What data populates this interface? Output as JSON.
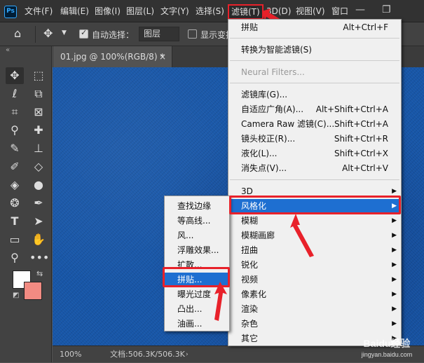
{
  "menubar": {
    "logo": "Ps",
    "items": [
      "文件(F)",
      "编辑(E)",
      "图像(I)",
      "图层(L)",
      "文字(Y)",
      "选择(S)",
      "滤镜(T)",
      "3D(D)",
      "视图(V)",
      "窗口"
    ],
    "window_controls": [
      "—",
      "❐"
    ]
  },
  "options": {
    "auto_select_label": "自动选择：",
    "layer_select_value": "图层",
    "show_transform_label": "显示变换"
  },
  "document": {
    "tab_title": "01.jpg @ 100%(RGB/8) *",
    "tab_close": "×",
    "zoom": "100%",
    "doc_info": "文档:506.3K/506.3K"
  },
  "filter_menu": {
    "items": [
      {
        "label": "拼贴",
        "shortcut": "Alt+Ctrl+F"
      },
      {
        "label": "转换为智能滤镜(S)",
        "shortcut": ""
      },
      {
        "label": "Neural Filters...",
        "shortcut": "",
        "disabled": true
      },
      {
        "label": "滤镜库(G)...",
        "shortcut": ""
      },
      {
        "label": "自适应广角(A)...",
        "shortcut": "Alt+Shift+Ctrl+A"
      },
      {
        "label": "Camera Raw 滤镜(C)...",
        "shortcut": "Shift+Ctrl+A"
      },
      {
        "label": "镜头校正(R)...",
        "shortcut": "Shift+Ctrl+R"
      },
      {
        "label": "液化(L)...",
        "shortcut": "Shift+Ctrl+X"
      },
      {
        "label": "消失点(V)...",
        "shortcut": "Alt+Ctrl+V"
      },
      {
        "label": "3D",
        "shortcut": ""
      },
      {
        "label": "风格化",
        "shortcut": ""
      },
      {
        "label": "模糊",
        "shortcut": ""
      },
      {
        "label": "模糊画廊",
        "shortcut": ""
      },
      {
        "label": "扭曲",
        "shortcut": ""
      },
      {
        "label": "锐化",
        "shortcut": ""
      },
      {
        "label": "视频",
        "shortcut": ""
      },
      {
        "label": "像素化",
        "shortcut": ""
      },
      {
        "label": "渲染",
        "shortcut": ""
      },
      {
        "label": "杂色",
        "shortcut": ""
      },
      {
        "label": "其它",
        "shortcut": ""
      }
    ]
  },
  "stylize_submenu": {
    "items": [
      "查找边缘",
      "等高线...",
      "风...",
      "浮雕效果...",
      "扩散...",
      "拼贴...",
      "曝光过度",
      "凸出...",
      "油画..."
    ]
  },
  "colors": {
    "foreground": "#ffffff",
    "background": "#f28b82",
    "highlight": "#1e6fd1",
    "annotation": "#e8212a"
  },
  "watermark": {
    "brand": "Baidu经验",
    "url": "jingyan.baidu.com"
  }
}
